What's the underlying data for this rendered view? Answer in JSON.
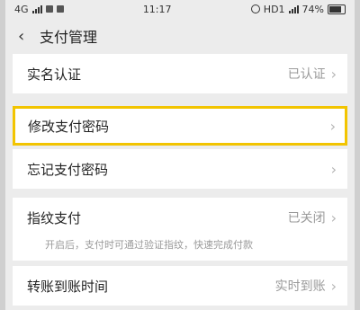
{
  "status": {
    "network": "4G",
    "time": "11:17",
    "hd": "HD1",
    "battery": "74%"
  },
  "header": {
    "back_icon": "chevron-left-icon",
    "title": "支付管理"
  },
  "items": {
    "realname": {
      "label": "实名认证",
      "value": "已认证"
    },
    "change_pwd": {
      "label": "修改支付密码"
    },
    "forgot_pwd": {
      "label": "忘记支付密码"
    },
    "fingerprint": {
      "label": "指纹支付",
      "value": "已关闭",
      "hint": "开启后，支付时可通过验证指纹，快速完成付款"
    },
    "transfer": {
      "label": "转账到账时间",
      "value": "实时到账"
    }
  },
  "colors": {
    "highlight": "#f2c400",
    "background": "#ececec"
  }
}
